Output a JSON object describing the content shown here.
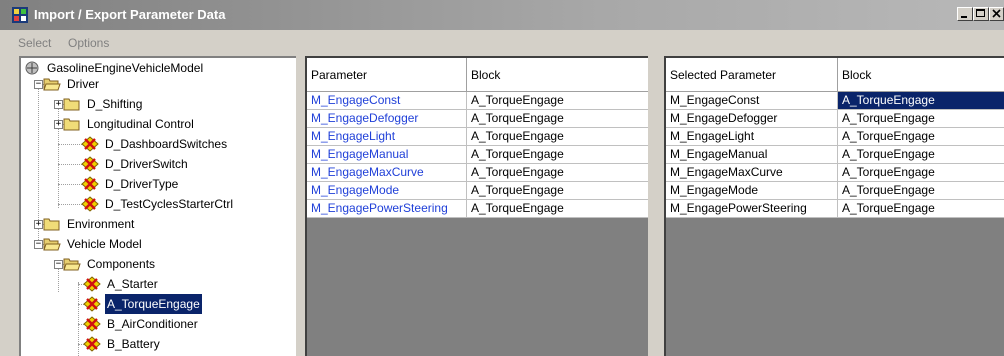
{
  "window": {
    "title": "Import / Export Parameter Data",
    "buttons": [
      "minimize",
      "maximize",
      "close"
    ]
  },
  "menu": {
    "items": [
      "Select",
      "Options"
    ]
  },
  "tree": {
    "items": [
      {
        "label": "GasolineEngineVehicleModel",
        "icon": "model-icon"
      },
      {
        "label": "Driver",
        "icon": "folder-open-icon"
      },
      {
        "label": "D_Shifting",
        "icon": "folder-icon"
      },
      {
        "label": "Longitudinal Control",
        "icon": "folder-icon"
      },
      {
        "label": "D_DashboardSwitches",
        "icon": "block-icon"
      },
      {
        "label": "D_DriverSwitch",
        "icon": "block-icon"
      },
      {
        "label": "D_DriverType",
        "icon": "block-icon"
      },
      {
        "label": "D_TestCyclesStarterCtrl",
        "icon": "block-icon"
      },
      {
        "label": "Environment",
        "icon": "folder-icon"
      },
      {
        "label": "Vehicle Model",
        "icon": "folder-open-icon"
      },
      {
        "label": "Components",
        "icon": "folder-open-icon"
      },
      {
        "label": "A_Starter",
        "icon": "block-icon"
      },
      {
        "label": "A_TorqueEngage",
        "icon": "block-icon",
        "selected": true
      },
      {
        "label": "B_AirConditioner",
        "icon": "block-icon"
      },
      {
        "label": "B_Battery",
        "icon": "block-icon"
      }
    ]
  },
  "available_grid": {
    "headers": [
      "Parameter",
      "Block"
    ],
    "rows": [
      [
        "M_EngageConst",
        "A_TorqueEngage"
      ],
      [
        "M_EngageDefogger",
        "A_TorqueEngage"
      ],
      [
        "M_EngageLight",
        "A_TorqueEngage"
      ],
      [
        "M_EngageManual",
        "A_TorqueEngage"
      ],
      [
        "M_EngageMaxCurve",
        "A_TorqueEngage"
      ],
      [
        "M_EngageMode",
        "A_TorqueEngage"
      ],
      [
        "M_EngagePowerSteering",
        "A_TorqueEngage"
      ]
    ]
  },
  "selected_grid": {
    "headers": [
      "Selected Parameter",
      "Block"
    ],
    "rows": [
      [
        "M_EngageConst",
        "A_TorqueEngage"
      ],
      [
        "M_EngageDefogger",
        "A_TorqueEngage"
      ],
      [
        "M_EngageLight",
        "A_TorqueEngage"
      ],
      [
        "M_EngageManual",
        "A_TorqueEngage"
      ],
      [
        "M_EngageMaxCurve",
        "A_TorqueEngage"
      ],
      [
        "M_EngageMode",
        "A_TorqueEngage"
      ],
      [
        "M_EngagePowerSteering",
        "A_TorqueEngage"
      ]
    ],
    "selected_cell": {
      "row": 0,
      "col": 1
    }
  },
  "colors": {
    "selection": "#0a246a",
    "link_text": "#1f3fd8",
    "window_bg": "#d4d0c8"
  }
}
